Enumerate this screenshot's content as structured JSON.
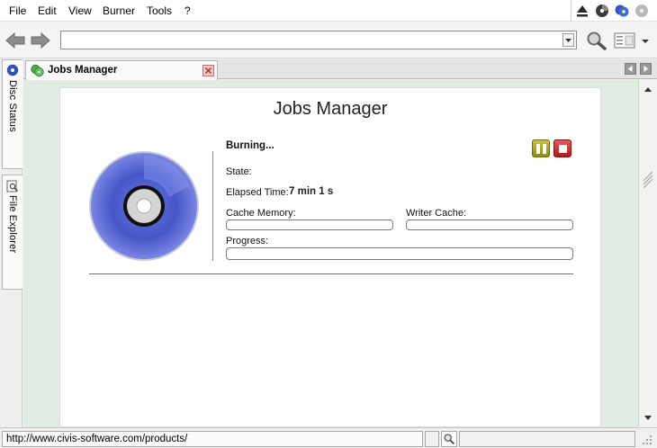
{
  "menu": {
    "file": "File",
    "edit": "Edit",
    "view": "View",
    "burner": "Burner",
    "tools": "Tools",
    "help": "?"
  },
  "top_icons": [
    "eject-icon",
    "disc-dark-icon",
    "disc-blue-icon",
    "disc-gray-icon"
  ],
  "toolbar": {
    "address_value": ""
  },
  "side_tabs": {
    "disc_status": "Disc Status",
    "file_explorer": "File Explorer"
  },
  "doc_tab": {
    "title": "Jobs Manager"
  },
  "jobs": {
    "title": "Jobs Manager",
    "status": "Burning...",
    "state_label": "State:",
    "elapsed_label": "Elapsed Time:",
    "elapsed_value": "7 min 1 s",
    "cache_label": "Cache Memory:",
    "writer_label": "Writer Cache:",
    "progress_label": "Progress:",
    "cache_level": 0,
    "writer_level": 0,
    "progress_level": 0
  },
  "statusbar": {
    "url": "http://www.civis-software.com/products/"
  },
  "colors": {
    "disc_blue": "#4656c8",
    "pause_olive": "#a8a21e",
    "stop_red": "#d02828",
    "content_bg": "#e2ebe1"
  }
}
